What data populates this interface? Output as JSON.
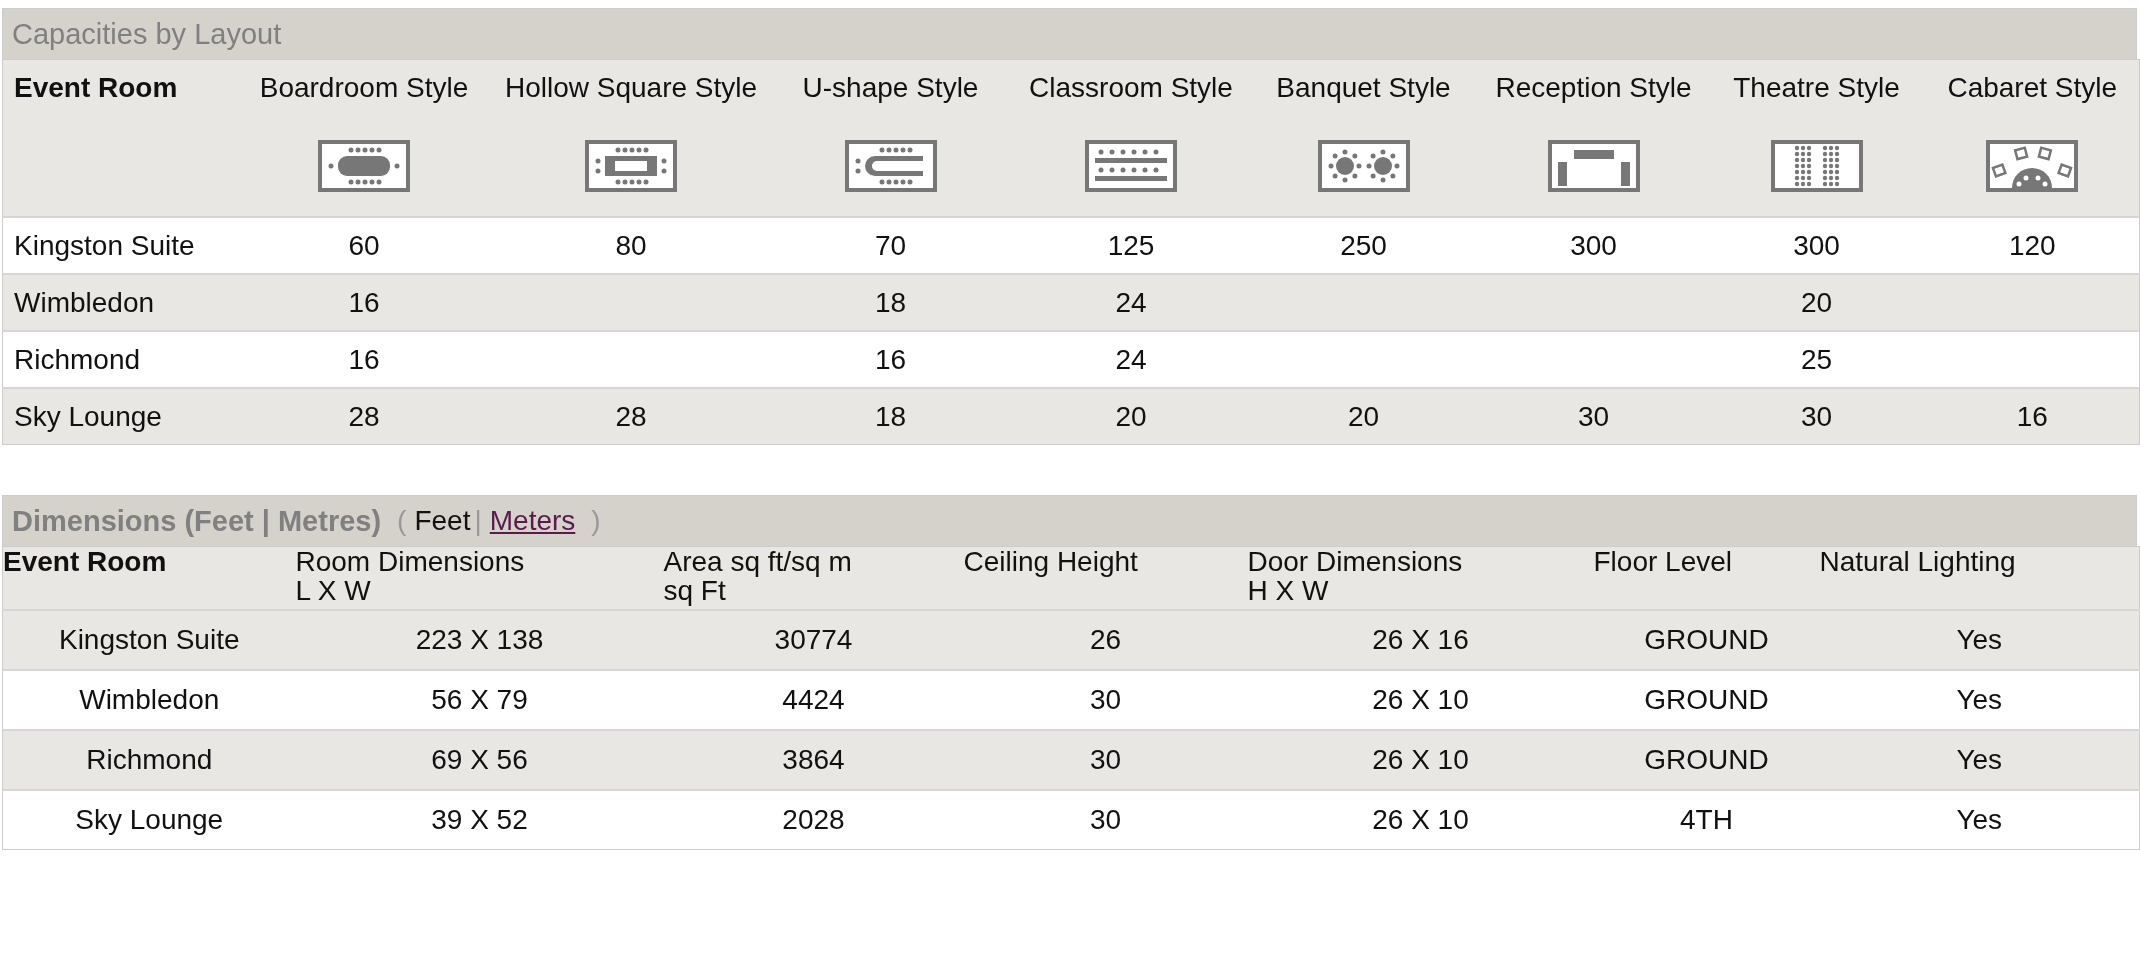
{
  "capacities": {
    "title": "Capacities by Layout",
    "columns": [
      "Event Room",
      "Boardroom Style",
      "Hollow Square Style",
      "U-shape Style",
      "Classroom Style",
      "Banquet Style",
      "Reception Style",
      "Theatre Style",
      "Cabaret Style"
    ],
    "rows": [
      {
        "cells": [
          "Kingston Suite",
          "60",
          "80",
          "70",
          "125",
          "250",
          "300",
          "300",
          "120"
        ]
      },
      {
        "cells": [
          "Wimbledon",
          "16",
          "",
          "18",
          "24",
          "",
          "",
          "20",
          ""
        ]
      },
      {
        "cells": [
          "Richmond",
          "16",
          "",
          "16",
          "24",
          "",
          "",
          "25",
          ""
        ]
      },
      {
        "cells": [
          "Sky Lounge",
          "28",
          "28",
          "18",
          "20",
          "20",
          "30",
          "30",
          "16"
        ]
      }
    ]
  },
  "dimensions": {
    "title": "Dimensions (Feet | Metres)",
    "open": "(",
    "close": ")",
    "separator": "|",
    "units": [
      {
        "label": "Feet",
        "selected": true
      },
      {
        "label": "Meters",
        "selected": false
      }
    ],
    "columns": [
      {
        "lines": [
          "Event Room"
        ]
      },
      {
        "lines": [
          "Room Dimensions",
          "L X W"
        ]
      },
      {
        "lines": [
          "Area sq ft/sq m",
          "sq Ft"
        ]
      },
      {
        "lines": [
          "Ceiling Height"
        ]
      },
      {
        "lines": [
          "Door Dimensions",
          "H X W"
        ]
      },
      {
        "lines": [
          "Floor Level"
        ]
      },
      {
        "lines": [
          "Natural Lighting"
        ]
      }
    ],
    "rows": [
      {
        "cells": [
          "Kingston Suite",
          "223 X 138",
          "30774",
          "26",
          "26 X 16",
          "GROUND",
          "Yes"
        ]
      },
      {
        "cells": [
          "Wimbledon",
          "56 X 79",
          "4424",
          "30",
          "26 X 10",
          "GROUND",
          "Yes"
        ]
      },
      {
        "cells": [
          "Richmond",
          "69 X 56",
          "3864",
          "30",
          "26 X 10",
          "GROUND",
          "Yes"
        ]
      },
      {
        "cells": [
          "Sky Lounge",
          "39 X 52",
          "2028",
          "30",
          "26 X 10",
          "4TH",
          "Yes"
        ]
      }
    ]
  }
}
